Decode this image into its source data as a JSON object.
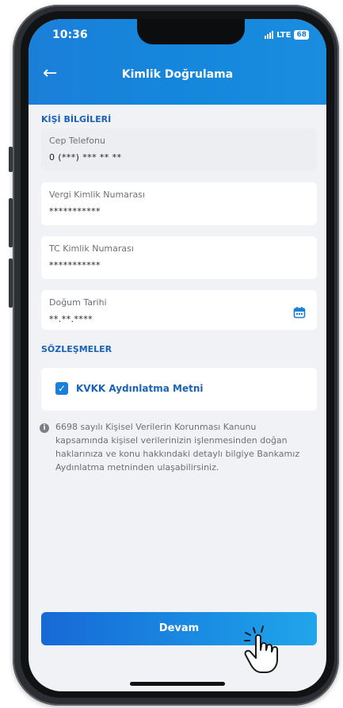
{
  "status_bar": {
    "time": "10:36",
    "network": "LTE",
    "battery": "68"
  },
  "header": {
    "title": "Kimlik Doğrulama",
    "back_icon": "back-arrow-icon"
  },
  "sections": {
    "personal_info": "KİŞİ BİLGİLERİ",
    "agreements": "SÖZLEŞMELER"
  },
  "fields": [
    {
      "label": "Cep Telefonu",
      "value": "0 (***) *** ** **"
    },
    {
      "label": "Vergi Kimlik Numarası",
      "value": "***********"
    },
    {
      "label": "TC Kimlik Numarası",
      "value": "***********"
    },
    {
      "label": "Doğum Tarihi",
      "value": "**.**.****"
    }
  ],
  "consent": {
    "label": "KVKK Aydınlatma Metni",
    "checked": true
  },
  "info_text": "6698 sayılı Kişisel Verilerin Korunması Kanunu kapsamında kişisel verilerinizin işlenmesinden doğan haklarınıza ve konu hakkındaki detaylı bilgiye Bankamız Aydınlatma metninden ulaşabilirsiniz.",
  "button": {
    "label": "Devam"
  },
  "colors": {
    "primary": "#1a7fd8",
    "label_blue": "#1a62b8",
    "background": "#f0f2f5"
  }
}
